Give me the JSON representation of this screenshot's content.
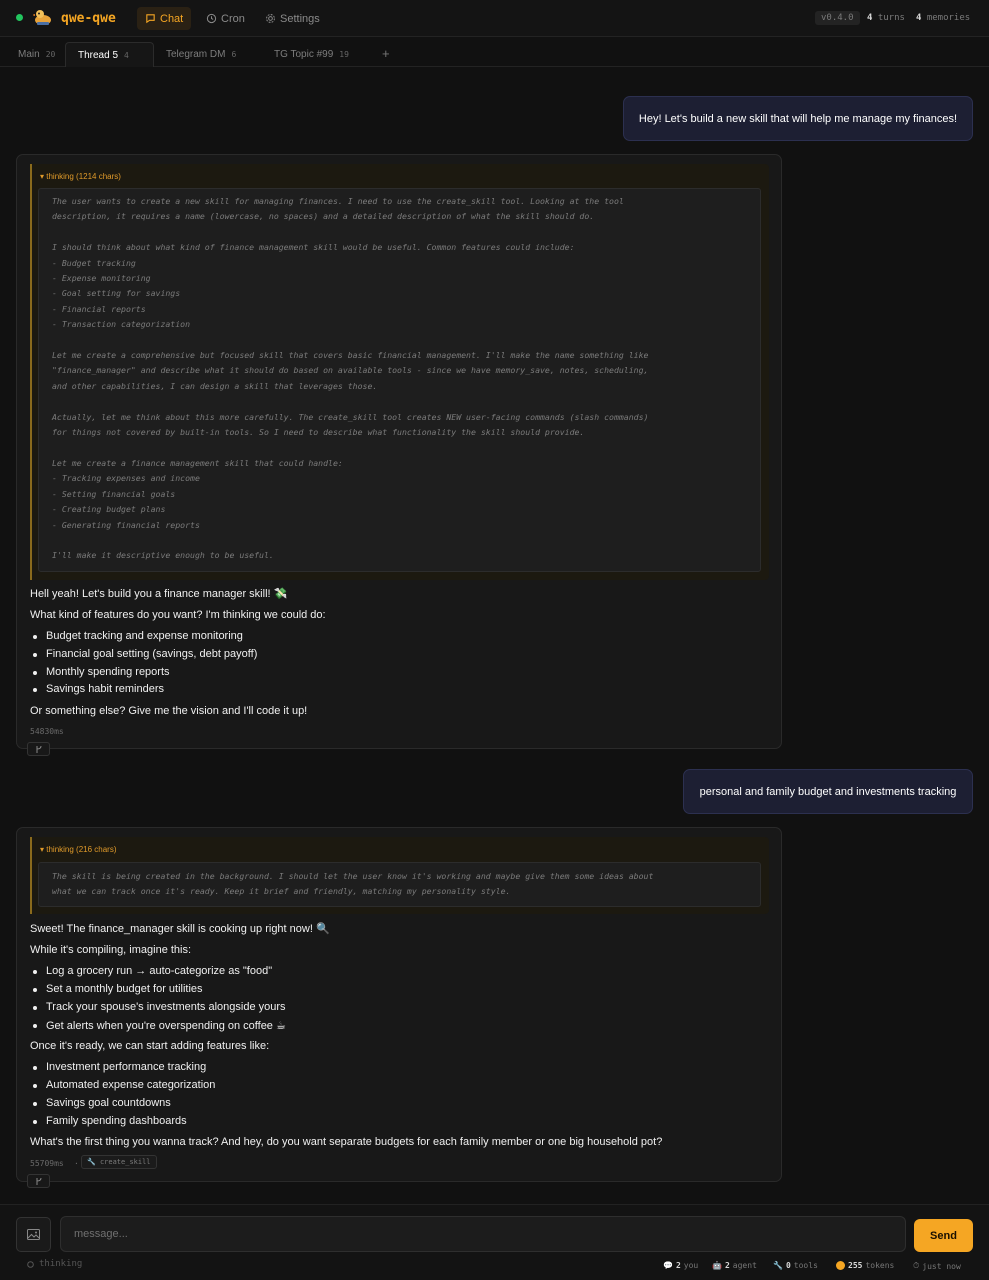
{
  "app": {
    "name": "qwe-qwe",
    "version": "v0.4.0",
    "turns_count": "4",
    "turns_label": "turns",
    "memories_count": "4",
    "memories_label": "memories"
  },
  "nav": {
    "chat": "Chat",
    "cron": "Cron",
    "settings": "Settings"
  },
  "tabs": [
    {
      "label": "Main",
      "count": "20"
    },
    {
      "label": "Thread 5",
      "count": "4"
    },
    {
      "label": "Telegram DM",
      "count": "6"
    },
    {
      "label": "TG Topic #99",
      "count": "19"
    }
  ],
  "tab_add": "+",
  "messages": {
    "user1": "Hey! Let's build a new skill that will help me manage my finances!",
    "agent1": {
      "thinking_label": "▾ thinking (1214 chars)",
      "thinking_text": "The user wants to create a new skill for managing finances. I need to use the create_skill tool. Looking at the tool\ndescription, it requires a name (lowercase, no spaces) and a detailed description of what the skill should do.\n\nI should think about what kind of finance management skill would be useful. Common features could include:\n- Budget tracking\n- Expense monitoring\n- Goal setting for savings\n- Financial reports\n- Transaction categorization\n\nLet me create a comprehensive but focused skill that covers basic financial management. I'll make the name something like\n\"finance_manager\" and describe what it should do based on available tools - since we have memory_save, notes, scheduling,\nand other capabilities, I can design a skill that leverages those.\n\nActually, let me think about this more carefully. The create_skill tool creates NEW user-facing commands (slash commands)\nfor things not covered by built-in tools. So I need to describe what functionality the skill should provide.\n\nLet me create a finance management skill that could handle:\n- Tracking expenses and income\n- Setting financial goals\n- Creating budget plans\n- Generating financial reports\n\nI'll make it descriptive enough to be useful.",
      "intro": "Hell yeah! Let's build you a finance manager skill! 💸",
      "question": "What kind of features do you want? I'm thinking we could do:",
      "bullets": [
        "Budget tracking and expense monitoring",
        "Financial goal setting (savings, debt payoff)",
        "Monthly spending reports",
        "Savings habit reminders"
      ],
      "outro": "Or something else? Give me the vision and I'll code it up!",
      "time": "54830ms"
    },
    "user2": "personal and family budget and investments tracking",
    "agent2": {
      "thinking_label": "▾ thinking (216 chars)",
      "thinking_text": "The skill is being created in the background. I should let the user know it's working and maybe give them some ideas about\nwhat we can track once it's ready. Keep it brief and friendly, matching my personality style.",
      "intro": "Sweet! The finance_manager skill is cooking up right now! 🔍",
      "compiling": "While it's compiling, imagine this:",
      "bullets1": [
        "Log a grocery run → auto-categorize as \"food\"",
        "Set a monthly budget for utilities",
        "Track your spouse's investments alongside yours",
        "Get alerts when you're overspending on coffee ☕"
      ],
      "ready": "Once it's ready, we can start adding features like:",
      "bullets2": [
        "Investment performance tracking",
        "Automated expense categorization",
        "Savings goal countdowns",
        "Family spending dashboards"
      ],
      "outro": "What's the first thing you wanna track? And hey, do you want separate budgets for each family member or one big household pot?",
      "time": "55709ms",
      "separator": "·",
      "tool": "create_skill"
    }
  },
  "composer": {
    "placeholder": "message...",
    "send": "Send",
    "thinking": "thinking"
  },
  "footer": {
    "you_count": "2",
    "you_label": "you",
    "agent_count": "2",
    "agent_label": "agent",
    "tools_count": "0",
    "tools_label": "tools",
    "tokens_count": "255",
    "tokens_label": "tokens",
    "time": "just now"
  },
  "colors": {
    "accent": "#f5a623",
    "status_online": "#22c55e",
    "user_bubble": "#1d1f33"
  }
}
